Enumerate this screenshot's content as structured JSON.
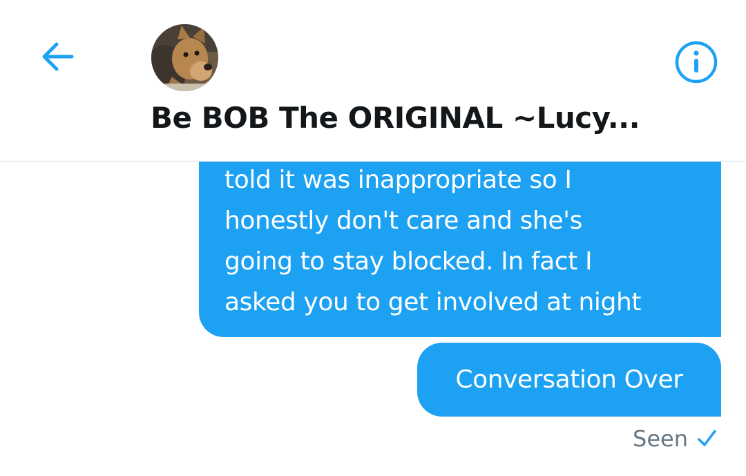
{
  "header": {
    "back_icon": "arrow-left-icon",
    "avatar_alt": "dog-avatar",
    "title": "Be BOB The ORIGINAL ~Lucy...",
    "info_icon": "info-circle-icon"
  },
  "messages": [
    {
      "text": "told it was inappropriate so I\nhonestly don't care and she's\ngoing to stay blocked. In fact I\nasked you to get involved at night"
    },
    {
      "text": "Conversation Over"
    }
  ],
  "status": {
    "label": "Seen",
    "icon": "checkmark-icon"
  },
  "colors": {
    "accent": "#1da1f2",
    "title": "#14171a",
    "secondary_text": "#657786",
    "divider": "#e1e8ed"
  }
}
